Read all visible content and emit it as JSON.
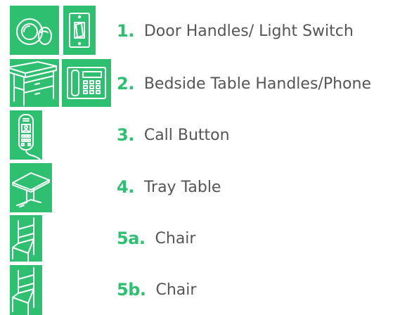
{
  "items": [
    {
      "number": "1.",
      "label": "Door Handles/ Light Switch",
      "icons": [
        "door-knob-icon",
        "light-switch-icon"
      ]
    },
    {
      "number": "2.",
      "label": "Bedside Table Handles/Phone",
      "icons": [
        "bedside-table-icon",
        "desk-phone-icon"
      ]
    },
    {
      "number": "3.",
      "label": "Call Button",
      "icons": [
        "call-button-remote-icon"
      ]
    },
    {
      "number": "4.",
      "label": "Tray Table",
      "icons": [
        "tray-table-icon"
      ]
    },
    {
      "number": "5a.",
      "label": "Chair",
      "icons": [
        "chair-icon"
      ]
    },
    {
      "number": "5b.",
      "label": "Chair",
      "icons": [
        "chair-icon"
      ]
    }
  ],
  "colors": {
    "accent": "#2fbf71",
    "text": "#555555",
    "icon_stroke": "#ffffff"
  }
}
